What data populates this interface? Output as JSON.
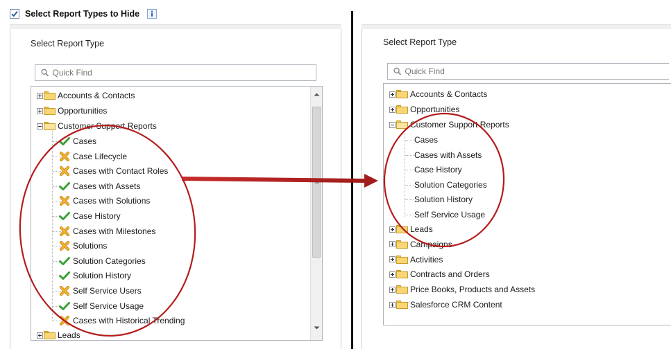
{
  "header": {
    "title": "Select Report Types to Hide",
    "checked": true,
    "info_icon": "i"
  },
  "left": {
    "label": "Select Report Type",
    "quick_find_placeholder": "Quick Find",
    "top_folders": [
      "Accounts & Contacts",
      "Opportunities"
    ],
    "open_folder": "Customer Support Reports",
    "items": [
      {
        "label": "Cases",
        "status": "check"
      },
      {
        "label": "Case Lifecycle",
        "status": "x"
      },
      {
        "label": "Cases with Contact Roles",
        "status": "x"
      },
      {
        "label": "Cases with Assets",
        "status": "check"
      },
      {
        "label": "Cases with Solutions",
        "status": "x"
      },
      {
        "label": "Case History",
        "status": "check"
      },
      {
        "label": "Cases with Milestones",
        "status": "x"
      },
      {
        "label": "Solutions",
        "status": "x"
      },
      {
        "label": "Solution Categories",
        "status": "check"
      },
      {
        "label": "Solution History",
        "status": "check"
      },
      {
        "label": "Self Service Users",
        "status": "x"
      },
      {
        "label": "Self Service Usage",
        "status": "check"
      },
      {
        "label": "Cases with Historical Trending",
        "status": "x"
      }
    ],
    "bottom_folder": "Leads"
  },
  "right": {
    "label": "Select Report Type",
    "quick_find_placeholder": "Quick Find",
    "top_folders": [
      "Accounts & Contacts",
      "Opportunities"
    ],
    "open_folder": "Customer Support Reports",
    "items": [
      "Cases",
      "Cases with Assets",
      "Case History",
      "Solution Categories",
      "Solution History",
      "Self Service Usage"
    ],
    "bottom_folders": [
      "Leads",
      "Campaigns",
      "Activities",
      "Contracts and Orders",
      "Price Books, Products and Assets",
      "Salesforce CRM Content"
    ]
  },
  "colors": {
    "annotation_red": "#b51c1c",
    "check_green": "#3aa035",
    "x_orange": "#eda319",
    "folder_yellow": "#f8d675"
  },
  "icons": [
    "checkbox-icon",
    "info-icon",
    "search-icon",
    "expand-icon",
    "collapse-icon",
    "folder-icon",
    "checkmark-icon",
    "x-mark-icon",
    "scroll-up-icon",
    "scroll-down-icon"
  ]
}
